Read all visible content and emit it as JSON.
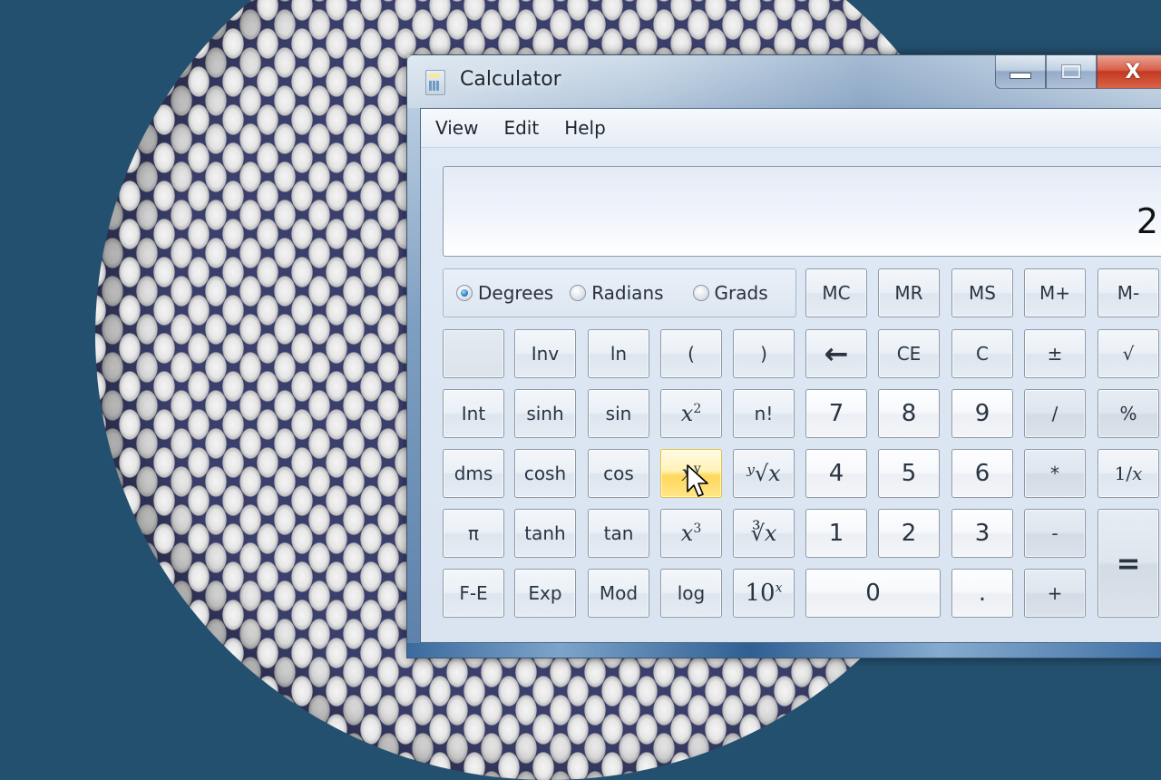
{
  "window": {
    "title": "Calculator",
    "app_icon": "calculator-icon",
    "caption_buttons": {
      "minimize": "minimize-icon",
      "maximize": "maximize-icon",
      "close": "close-icon",
      "close_glyph": "X"
    }
  },
  "menu": {
    "items": [
      "View",
      "Edit",
      "Help"
    ]
  },
  "display": {
    "value": "2"
  },
  "angle_units": {
    "options": [
      {
        "label": "Degrees",
        "checked": true
      },
      {
        "label": "Radians",
        "checked": false
      },
      {
        "label": "Grads",
        "checked": false
      }
    ]
  },
  "memory_buttons": [
    "MC",
    "MR",
    "MS",
    "M+",
    "M-"
  ],
  "buttons": {
    "row2": [
      "",
      "Inv",
      "ln",
      "(",
      ")",
      "←",
      "CE",
      "C",
      "±",
      "√"
    ],
    "row3": [
      "Int",
      "sinh",
      "sin",
      "x²",
      "n!",
      "7",
      "8",
      "9",
      "/",
      "%"
    ],
    "row4": [
      "dms",
      "cosh",
      "cos",
      "xʸ",
      "ʸ√x",
      "4",
      "5",
      "6",
      "*",
      "1/x"
    ],
    "row5": [
      "π",
      "tanh",
      "tan",
      "x³",
      "∛x",
      "1",
      "2",
      "3",
      "-",
      "="
    ],
    "row6": [
      "F-E",
      "Exp",
      "Mod",
      "log",
      "10ˣ",
      "0",
      ".",
      "+"
    ]
  },
  "math_labels": {
    "x": "x",
    "sup2": "2",
    "supy": "y",
    "sup3": "3",
    "root_y": "ʸ√",
    "root_3": "∛",
    "ten": "10",
    "supx": "x",
    "one_over": "1/"
  },
  "hovered_button": "xʸ",
  "colors": {
    "hover_highlight": "#ffd75a",
    "desktop": "#24506f",
    "close_button": "#c23a1f"
  }
}
